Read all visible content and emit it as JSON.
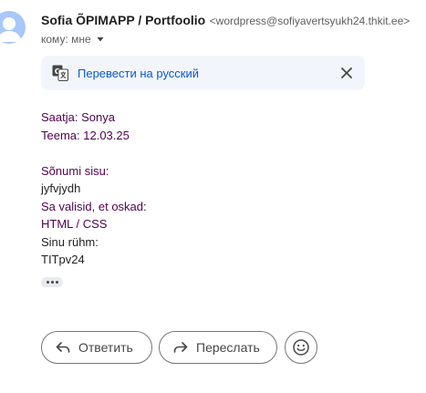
{
  "header": {
    "sender_name": "Sofia ÕPIMAPP / Portfoolio",
    "sender_email": "<wordpress@sofiyavertsyukh24.thkit.ee>",
    "recipient": "кому: мне"
  },
  "translate_bar": {
    "label": "Перевести на русский"
  },
  "message": {
    "lines": [
      "Saatja: Sonya",
      "Teema: 12.03.25",
      "",
      "Sõnumi sisu:",
      "jyfvjydh",
      "Sa valisid, et oskad:",
      "HTML / CSS",
      "Sinu rühm:",
      "TITpv24"
    ]
  },
  "actions": {
    "reply_label": "Ответить",
    "forward_label": "Переслать"
  },
  "icons": {
    "avatar": "person-avatar-icon",
    "recipient_caret": "caret-down-icon",
    "translate": "translate-icon",
    "close": "close-icon",
    "more": "more-dots-icon",
    "reply": "reply-icon",
    "forward": "forward-icon",
    "emoji": "emoji-icon"
  },
  "colors": {
    "accent": "#0b57d0",
    "translate_bar_bg": "#f2f6fc",
    "quoted_text": "#500050"
  }
}
